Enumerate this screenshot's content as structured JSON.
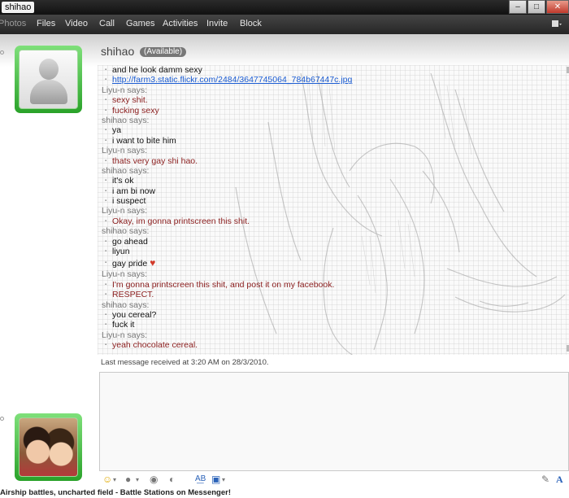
{
  "window": {
    "title": "shihao"
  },
  "menu": [
    {
      "label": "Photos",
      "dim": true
    },
    {
      "label": "Files"
    },
    {
      "label": "Video"
    },
    {
      "label": "Call"
    },
    {
      "label": "Games"
    },
    {
      "label": "Activities"
    },
    {
      "label": "Invite"
    },
    {
      "label": "Block"
    }
  ],
  "contact": {
    "name": "shihao",
    "status": "(Available)"
  },
  "conversation": [
    {
      "kind": "msg",
      "who": "self",
      "text": "and he look damm sexy"
    },
    {
      "kind": "link",
      "who": "self",
      "text": "http://farm3.static.flickr.com/2484/3647745064_784b67447c.jpg"
    },
    {
      "kind": "says",
      "text": "Liyu-n says:"
    },
    {
      "kind": "msg",
      "who": "other",
      "text": "sexy shit."
    },
    {
      "kind": "msg",
      "who": "other",
      "text": "fucking sexy"
    },
    {
      "kind": "says",
      "text": "shihao says:"
    },
    {
      "kind": "msg",
      "who": "self",
      "text": "ya"
    },
    {
      "kind": "msg",
      "who": "self",
      "text": "i want to bite him"
    },
    {
      "kind": "says",
      "text": "Liyu-n says:"
    },
    {
      "kind": "msg",
      "who": "other",
      "text": "thats very gay shi hao."
    },
    {
      "kind": "says",
      "text": "shihao says:"
    },
    {
      "kind": "msg",
      "who": "self",
      "text": "it's ok"
    },
    {
      "kind": "msg",
      "who": "self",
      "text": "i am bi now"
    },
    {
      "kind": "msg",
      "who": "self",
      "text": "i suspect"
    },
    {
      "kind": "says",
      "text": "Liyu-n says:"
    },
    {
      "kind": "msg",
      "who": "other",
      "text": "Okay, im gonna printscreen this shit."
    },
    {
      "kind": "says",
      "text": "shihao says:"
    },
    {
      "kind": "msg",
      "who": "self",
      "text": "go ahead"
    },
    {
      "kind": "msg",
      "who": "self",
      "text": "liyun"
    },
    {
      "kind": "msg",
      "who": "self",
      "text": "gay pride",
      "heart": true
    },
    {
      "kind": "says",
      "text": "Liyu-n says:"
    },
    {
      "kind": "msg",
      "who": "other",
      "text": "I'm gonna printscreen this shit, and post it on my facebook."
    },
    {
      "kind": "msg",
      "who": "other",
      "text": "RESPECT."
    },
    {
      "kind": "says",
      "text": "shihao says:"
    },
    {
      "kind": "msg",
      "who": "self",
      "text": "you cereal?"
    },
    {
      "kind": "msg",
      "who": "self",
      "text": "fuck it"
    },
    {
      "kind": "says",
      "text": "Liyu-n says:"
    },
    {
      "kind": "msg",
      "who": "other",
      "text": "yeah chocolate cereal."
    }
  ],
  "last_message": "Last message received at 3:20 AM on 28/3/2010.",
  "status_bar": "Airship battles, uncharted field - Battle Stations on Messenger!",
  "icons": {
    "heart": "♥",
    "close": "✕",
    "minimize": "–",
    "maximize": "□"
  }
}
